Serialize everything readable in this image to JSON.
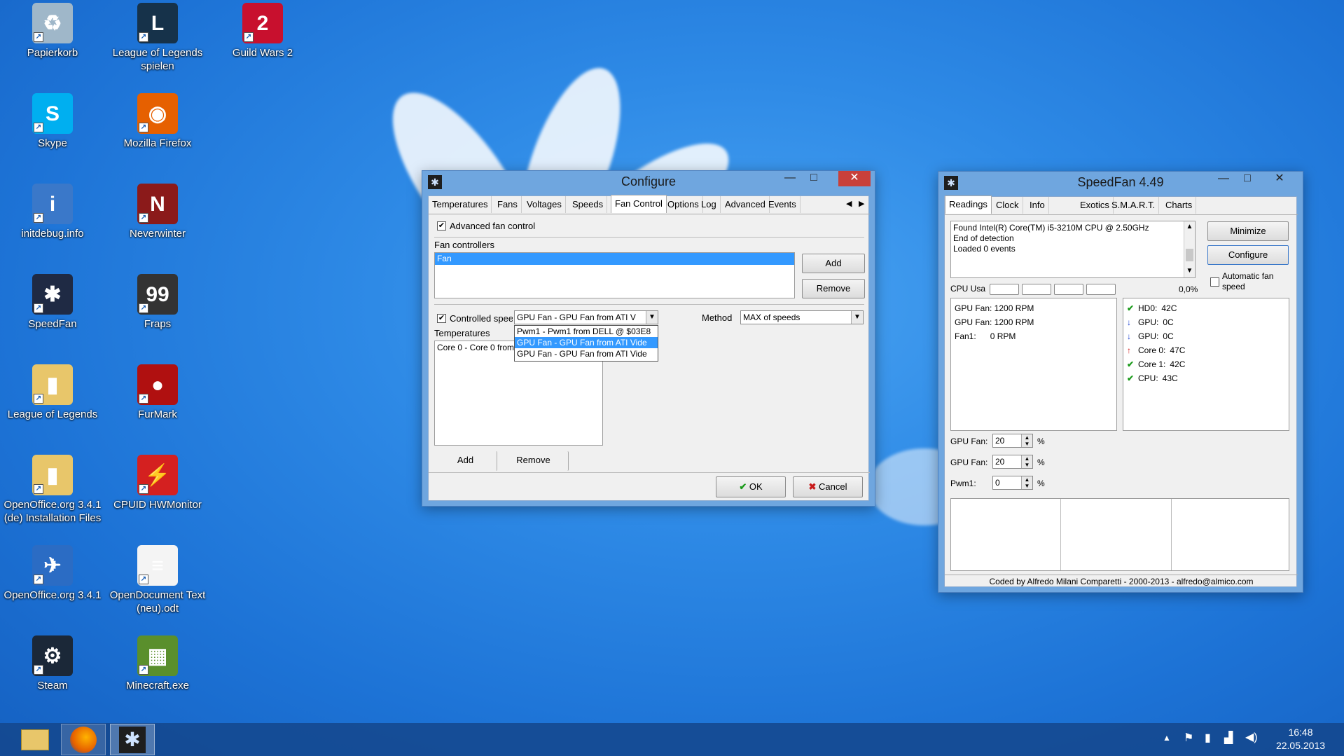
{
  "desktop_icons": [
    {
      "label": "Papierkorb",
      "icon": "recycle-bin-icon",
      "color": "#9fb7c9",
      "glyph": "♻"
    },
    {
      "label": "League of Legends spielen",
      "icon": "league-of-legends-icon",
      "color": "#16324a",
      "glyph": "L"
    },
    {
      "label": "Guild Wars 2",
      "icon": "guild-wars-2-icon",
      "color": "#c8102e",
      "glyph": "2"
    },
    {
      "label": "Skype",
      "icon": "skype-icon",
      "color": "#00aff0",
      "glyph": "S"
    },
    {
      "label": "Mozilla Firefox",
      "icon": "firefox-icon",
      "color": "#e66000",
      "glyph": "◉"
    },
    {
      "label": "initdebug.info",
      "icon": "info-file-icon",
      "color": "#3a78c9",
      "glyph": "i"
    },
    {
      "label": "Neverwinter",
      "icon": "neverwinter-icon",
      "color": "#8b1a1a",
      "glyph": "N"
    },
    {
      "label": "SpeedFan",
      "icon": "speedfan-icon",
      "color": "#1f2a44",
      "glyph": "✱"
    },
    {
      "label": "Fraps",
      "icon": "fraps-icon",
      "color": "#333",
      "glyph": "99"
    },
    {
      "label": "League of Legends",
      "icon": "folder-icon",
      "color": "#e8c66a",
      "glyph": "▮"
    },
    {
      "label": "FurMark",
      "icon": "furmark-icon",
      "color": "#b01010",
      "glyph": "●"
    },
    {
      "label": "OpenOffice.org 3.4.1 (de) Installation Files",
      "icon": "folder-icon",
      "color": "#e8c66a",
      "glyph": "▮"
    },
    {
      "label": "CPUID HWMonitor",
      "icon": "hwmonitor-icon",
      "color": "#d42020",
      "glyph": "⚡"
    },
    {
      "label": "OpenOffice.org 3.4.1",
      "icon": "openoffice-icon",
      "color": "#2b6cc4",
      "glyph": "✈"
    },
    {
      "label": "OpenDocument Text (neu).odt",
      "icon": "document-icon",
      "color": "#f4f4f4",
      "glyph": "≡"
    },
    {
      "label": "Steam",
      "icon": "steam-icon",
      "color": "#1b2838",
      "glyph": "⚙"
    },
    {
      "label": "Minecraft.exe",
      "icon": "minecraft-icon",
      "color": "#5a8f2c",
      "glyph": "▦"
    }
  ],
  "configure": {
    "title": "Configure",
    "tabs": [
      "Temperatures",
      "Fans",
      "Voltages",
      "Speeds",
      "Fan Control",
      "Options",
      "Log",
      "Advanced",
      "Events"
    ],
    "active_tab": "Fan Control",
    "advanced_fan_control": "Advanced fan control",
    "fan_controllers_label": "Fan controllers",
    "fan_controllers": [
      "Fan"
    ],
    "add": "Add",
    "remove": "Remove",
    "controlled_speed": "Controlled speed",
    "speed_combo": "GPU Fan - GPU Fan from ATI V",
    "dropdown_options": [
      "Pwm1 - Pwm1 from DELL @ $03E8",
      "GPU Fan - GPU Fan from ATI Vide",
      "GPU Fan - GPU Fan from ATI Vide"
    ],
    "method_label": "Method",
    "method_value": "MAX of speeds",
    "temperatures_label": "Temperatures",
    "temperatures": [
      "Core 0 - Core 0 from I"
    ],
    "add2": "Add",
    "remove2": "Remove",
    "ok": "OK",
    "cancel": "Cancel"
  },
  "speedfan": {
    "title": "SpeedFan 4.49",
    "tabs": [
      "Readings",
      "Clock",
      "Info",
      "Exotics",
      "S.M.A.R.T.",
      "Charts"
    ],
    "log_lines": [
      "Found Intel(R) Core(TM) i5-3210M CPU @ 2.50GHz",
      "End of detection",
      "Loaded 0 events"
    ],
    "minimize": "Minimize",
    "configure": "Configure",
    "auto_fan": "Automatic fan speed",
    "cpu_usage_label": "CPU Usa",
    "cpu_usage_value": "0,0%",
    "fans": [
      "GPU Fan: 1200 RPM",
      "GPU Fan: 1200 RPM",
      "Fan1:      0 RPM"
    ],
    "temps": [
      {
        "mark": "✔",
        "color": "#1a9a1a",
        "label": "HD0:",
        "value": "42C"
      },
      {
        "mark": "↓",
        "color": "#1a3fd0",
        "label": "GPU:",
        "value": "0C"
      },
      {
        "mark": "↓",
        "color": "#1a3fd0",
        "label": "GPU:",
        "value": "0C"
      },
      {
        "mark": "↑",
        "color": "#d01a1a",
        "label": "Core 0:",
        "value": "47C"
      },
      {
        "mark": "✔",
        "color": "#1a9a1a",
        "label": "Core 1:",
        "value": "42C"
      },
      {
        "mark": "✔",
        "color": "#1a9a1a",
        "label": "CPU:",
        "value": "43C"
      }
    ],
    "speed_rows": [
      {
        "label": "GPU Fan:",
        "value": "20",
        "unit": "%"
      },
      {
        "label": "GPU Fan:",
        "value": "20",
        "unit": "%"
      },
      {
        "label": "Pwm1:",
        "value": "0",
        "unit": "%"
      }
    ],
    "footer": "Coded by Alfredo Milani Comparetti - 2000-2013 - alfredo@almico.com"
  },
  "taskbar": {
    "time": "16:48",
    "date": "22.05.2013",
    "apps": [
      "file-explorer-icon",
      "firefox-icon",
      "speedfan-icon"
    ]
  }
}
